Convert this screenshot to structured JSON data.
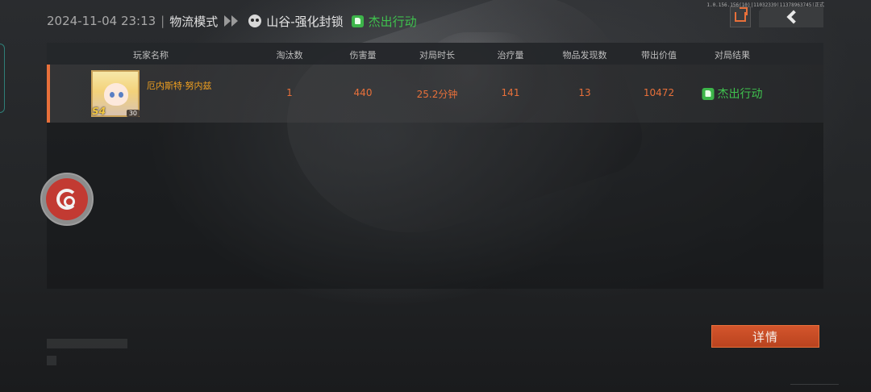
{
  "header": {
    "datetime": "2024-11-04 23:13",
    "separator": "|",
    "mode": "物流模式",
    "map": "山谷-强化封锁",
    "result": "杰出行动"
  },
  "build_info": "1.0.156.156(10)|11032339|11378963745|正式",
  "table": {
    "columns": [
      "玩家名称",
      "淘汰数",
      "伤害量",
      "对局时长",
      "治疗量",
      "物品发现数",
      "带出价值",
      "对局结果"
    ],
    "rows": [
      {
        "player_name": "厄内斯特·努内兹",
        "season_badge": "S4",
        "level": "30",
        "eliminations": "1",
        "damage": "440",
        "duration": "25.2分钟",
        "healing": "141",
        "items_found": "13",
        "extract_value": "10472",
        "result": "杰出行动"
      }
    ]
  },
  "buttons": {
    "detail": "详情"
  },
  "colors": {
    "accent": "#e8703a",
    "success": "#3fc24e",
    "player_name": "#f0a020"
  },
  "icons": {
    "share": "share-export-icon",
    "back": "chevron-left-icon",
    "map": "skull-icon",
    "result": "thumbs-up-icon",
    "floating": "netease-logo-icon"
  }
}
